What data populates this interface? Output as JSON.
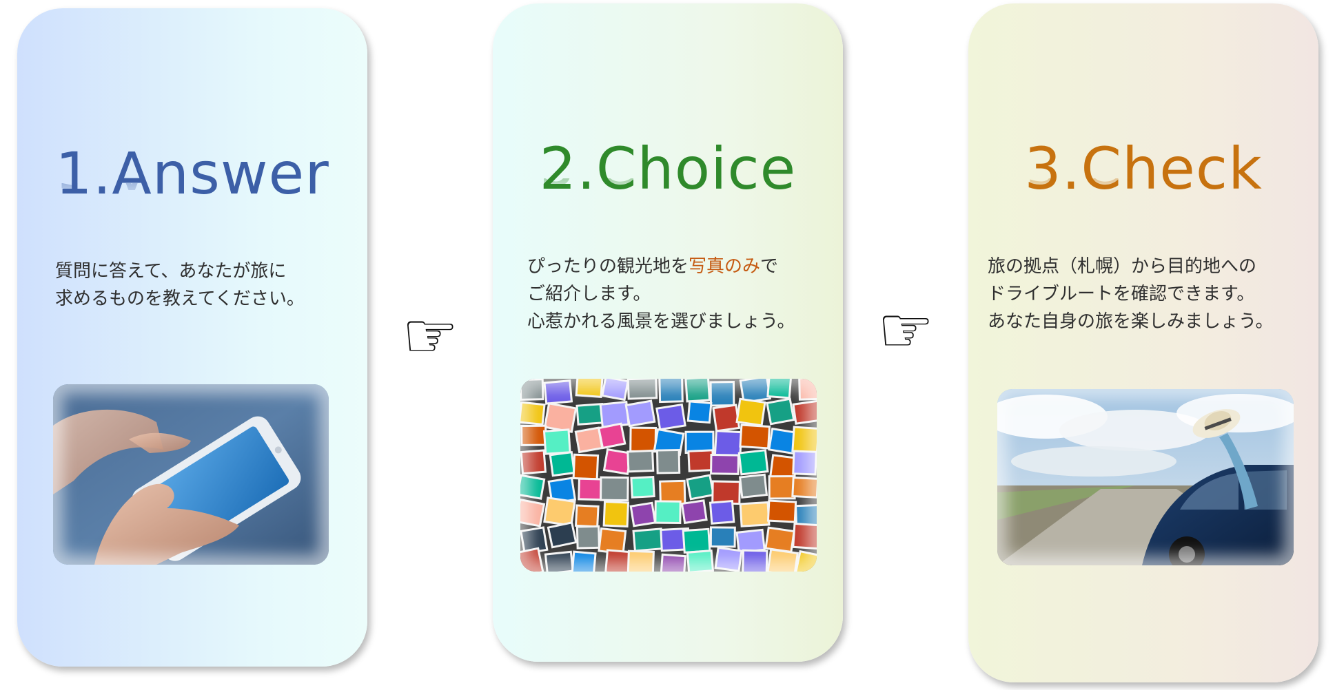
{
  "steps": [
    {
      "title": "1.Answer",
      "title_color": "#3c5fa7",
      "desc_lines": [
        "質問に答えて、あなたが旅に",
        "求めるものを教えてください。"
      ],
      "image": "smartphone-photo"
    },
    {
      "title": "2.Choice",
      "title_color": "#2f8a2b",
      "desc_line1_pre": "ぴったりの観光地を",
      "desc_line1_highlight": "写真のみ",
      "desc_line1_post": "で",
      "desc_line2": "ご紹介します。",
      "desc_line3": "心惹かれる風景を選びましょう。",
      "highlight_color": "#c55a11",
      "image": "photo-collage"
    },
    {
      "title": "3.Check",
      "title_color": "#c7720f",
      "desc_lines": [
        "旅の拠点（札幌）から目的地への",
        "ドライブルートを確認できます。",
        "あなた自身の旅を楽しみましょう。"
      ],
      "image": "road-trip-car-photo"
    }
  ],
  "pointer_glyph": "☞",
  "pointer_icon": "pointing-hand-icon"
}
